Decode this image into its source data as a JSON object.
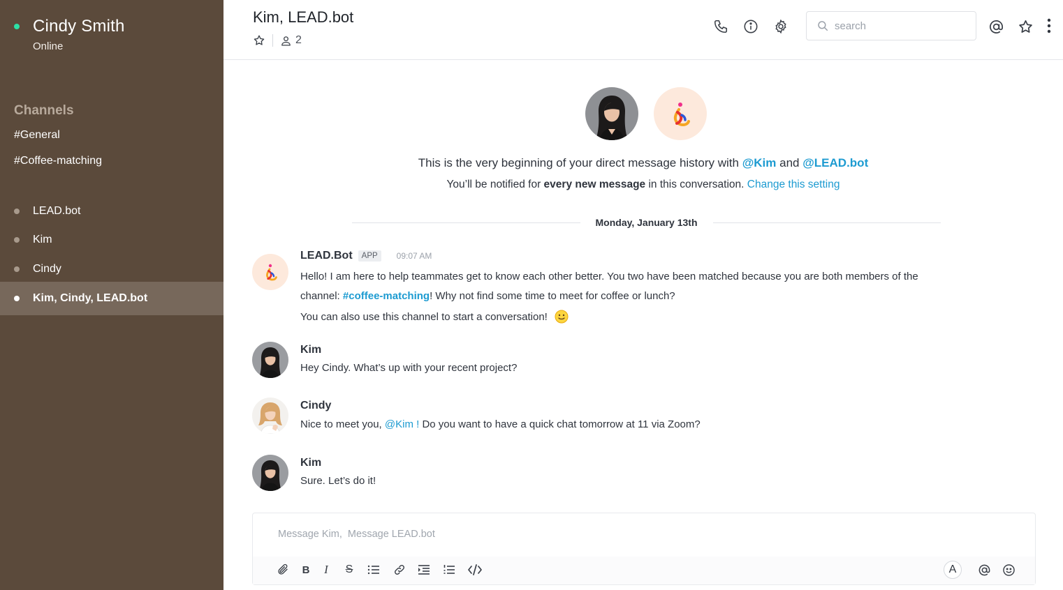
{
  "sidebar": {
    "user": {
      "name": "Cindy Smith",
      "status": "Online",
      "status_color": "#2de0a5"
    },
    "channels_title": "Channels",
    "channels": [
      "#General",
      "#Coffee-matching"
    ],
    "dms": [
      {
        "label": "LEAD.bot",
        "active": false
      },
      {
        "label": "Kim",
        "active": false
      },
      {
        "label": "Cindy",
        "active": false
      },
      {
        "label": "Kim, Cindy, LEAD.bot",
        "active": true
      }
    ]
  },
  "header": {
    "title": "Kim, LEAD.bot",
    "member_count": "2",
    "search_placeholder": "search",
    "icons": [
      "phone-icon",
      "info-icon",
      "settings-icon",
      "search-icon",
      "mention-icon",
      "star-icon",
      "kebab-menu-icon"
    ]
  },
  "intro": {
    "line1_prefix": "This is the very beginning of your direct message history with ",
    "mention1": "@Kim",
    "line1_and": " and ",
    "mention2": "@LEAD.bot",
    "line2_prefix": "You’ll be notified for ",
    "line2_bold": "every new message",
    "line2_mid": " in this conversation. ",
    "line2_link": "Change this setting"
  },
  "date_separator": "Monday, January 13th",
  "messages": [
    {
      "author": "LEAD.Bot",
      "badge": "APP",
      "time": "09:07 AM",
      "line1": "Hello! I am here to help teammates get to know each other better. You two have been matched because you are both members of the",
      "line2_prefix": "channel: ",
      "line2_link": "#coffee-matching",
      "line2_suffix": "! Why not find some time to meet for coffee or lunch?",
      "line3": "You can also use this channel to start a conversation!"
    },
    {
      "author": "Kim",
      "text": "Hey Cindy. What’s up with your recent project?"
    },
    {
      "author": "Cindy",
      "text_prefix": "Nice to meet you, ",
      "mention": "@Kim !",
      "text_suffix": " Do you want to have a quick chat tomorrow at 11 via Zoom?"
    },
    {
      "author": "Kim",
      "text": "Sure. Let’s do it!"
    }
  ],
  "composer": {
    "placeholder": "Message Kim,  Message LEAD.bot",
    "format_letter": "A",
    "tools": [
      "attach-icon",
      "bold-icon",
      "italic-icon",
      "strikethrough-icon",
      "bullet-list-icon",
      "link-icon",
      "indent-icon",
      "numbered-list-icon",
      "code-icon",
      "font-icon",
      "mention-icon",
      "emoji-icon"
    ]
  },
  "colors": {
    "sidebar_bg": "#5b4a3b",
    "active_item_bg": "#77685b",
    "link": "#1d9bd1",
    "online": "#2de0a5"
  }
}
